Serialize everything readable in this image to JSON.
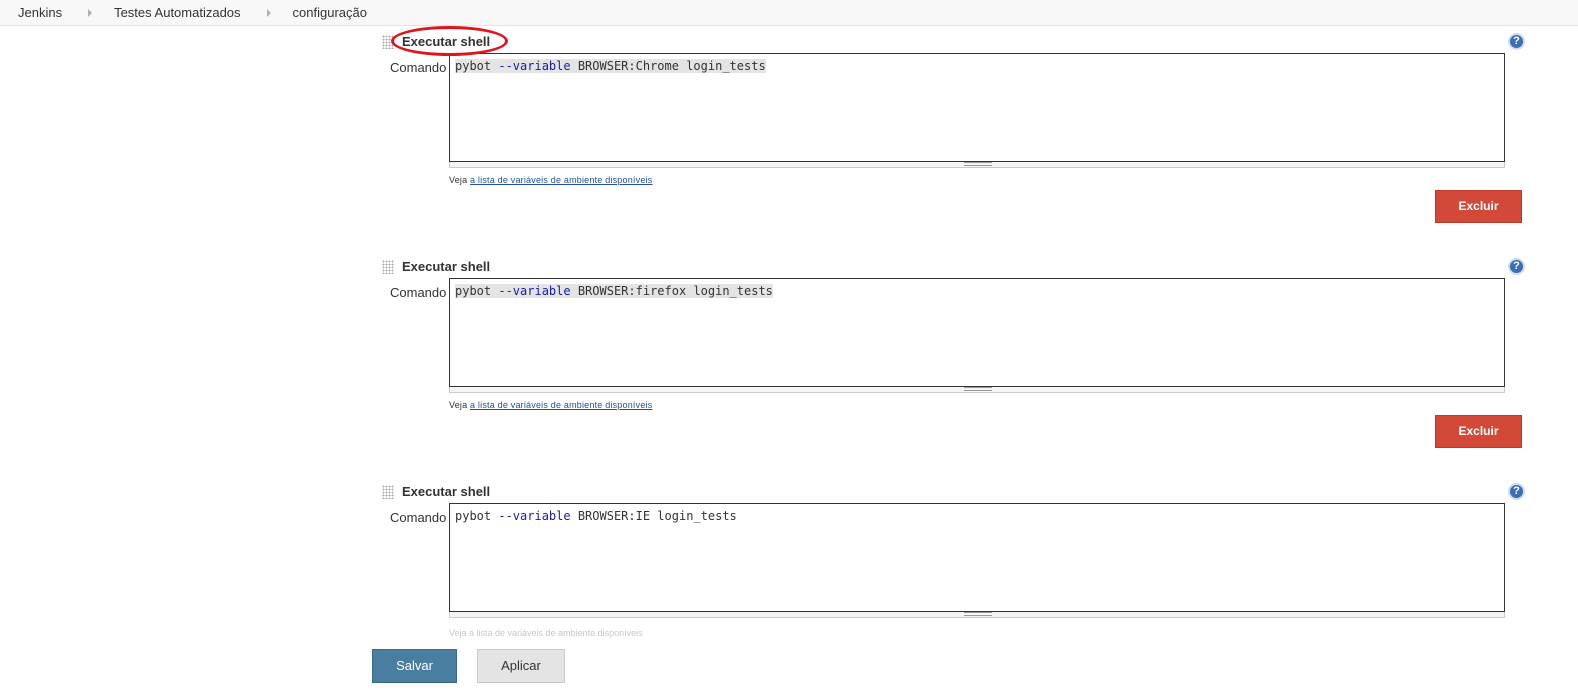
{
  "breadcrumb": {
    "items": [
      {
        "label": "Jenkins"
      },
      {
        "label": "Testes Automatizados"
      },
      {
        "label": "configuração"
      }
    ]
  },
  "steps": [
    {
      "title": "Executar shell",
      "command_label": "Comando",
      "command": {
        "prefix": "pybot ",
        "flag": "--variable",
        "rest": " BROWSER:Chrome login_tests"
      },
      "hint_prefix": "Veja ",
      "hint_link": "a lista de variáveis de ambiente disponíveis",
      "delete_label": "Excluir",
      "help_label": "?"
    },
    {
      "title": "Executar shell",
      "command_label": "Comando",
      "command": {
        "prefix": "pybot ",
        "flag": "--variable",
        "rest": " BROWSER:firefox login_tests"
      },
      "hint_prefix": "Veja ",
      "hint_link": "a lista de variáveis de ambiente disponíveis",
      "delete_label": "Excluir",
      "help_label": "?"
    },
    {
      "title": "Executar shell",
      "command_label": "Comando",
      "command": {
        "prefix": "pybot ",
        "flag": "--variable",
        "rest": " BROWSER:IE login_tests"
      },
      "hint_faded": "Veja a lista de variáveis de ambiente disponíveis",
      "help_label": "?"
    }
  ],
  "footer": {
    "save_label": "Salvar",
    "apply_label": "Aplicar"
  },
  "colors": {
    "delete_button": "#d24939",
    "save_button": "#4a7ea0",
    "highlight_ring": "#e0141d",
    "help_icon": "#3b6fb0"
  }
}
